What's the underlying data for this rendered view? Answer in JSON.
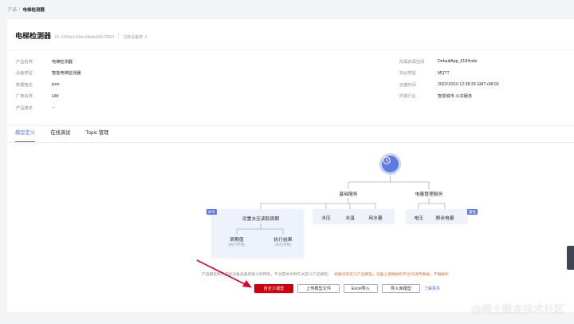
{
  "breadcrumb": {
    "parent": "产品",
    "separator": "/",
    "current": "电梯检测器"
  },
  "header": {
    "title": "电梯检测器",
    "product_id": "ID: 6343a1c50ec34a8a60b73000",
    "registered": "注册设备数: 0"
  },
  "info_left": [
    {
      "label": "产品名称",
      "value": "电梯检测器"
    },
    {
      "label": "设备类型",
      "value": "智能电梯监测器"
    },
    {
      "label": "数据格式",
      "value": "json"
    },
    {
      "label": "厂商名称",
      "value": "HW"
    },
    {
      "label": "产品描述",
      "value": "--"
    }
  ],
  "info_right": [
    {
      "label": "所属资源空间",
      "value": "DefaultApp_6184vsbr"
    },
    {
      "label": "协议类型",
      "value": "MQTT"
    },
    {
      "label": "创建时间",
      "value": "2022/10/10 12:38:33 GMT+08:00"
    },
    {
      "label": "所属行业",
      "value": "智慧城市-公共服务"
    }
  ],
  "tabs": [
    "模型定义",
    "在线调试",
    "Topic 管理"
  ],
  "tree": {
    "root_icon": "product-icon",
    "service_basic": "基础服务",
    "service_power": "电量管理服务",
    "cmd_tag": "命令",
    "property_tag": "属性",
    "command": "设置水压读取周期",
    "param_name": "周期值",
    "param_sub": "(执行参数)",
    "result_name": "执行结果",
    "result_sub": "(响应参数)",
    "basic_props": [
      "水压",
      "水温",
      "用水量"
    ],
    "power_props": [
      "电压",
      "剩余电量"
    ]
  },
  "hint": {
    "text1": "产品模型用于描述设备具备的能力和特性，平台提供多种方式定义产品模型：",
    "text2": "如果没有定义产品模型，设备上报数据时平台仅透传数据，不做解析"
  },
  "buttons": {
    "custom": "自定义模型",
    "upload": "上传模型文件",
    "excel": "Excel导入",
    "import": "导入库模型",
    "learn_more": "了解更多"
  },
  "watermark": "@稀土掘金技术社区",
  "colors": {
    "accent": "#5e7ce0",
    "primary_button": "#c7000b",
    "arrow": "#d9002b",
    "warning": "#e0743c"
  }
}
